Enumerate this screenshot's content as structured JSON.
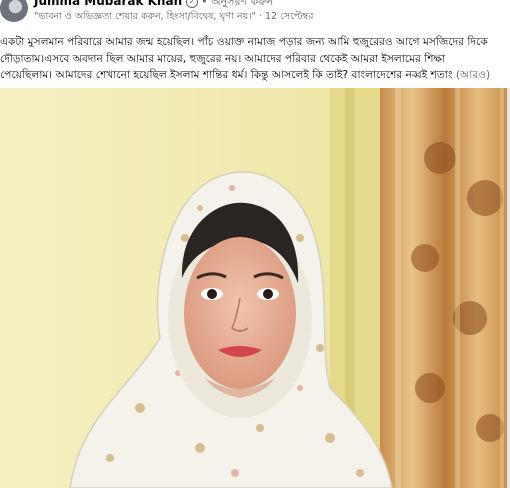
{
  "post": {
    "author": "Jumma Mubarak Khan",
    "follow_label": "• অনুসরণ করুন",
    "quote": "\"ভাবনা ও অভিজ্ঞতা শেয়ার করুন, হিংসা/বিদ্বেষ, ঘৃণা নয়।\"",
    "date": "· 12 সেপ্টেম্বর",
    "body_lines": [
      "একটা মুসলমান পরিবারে আমার জন্ম হয়েছিল। পাঁচ ওয়াক্ত নামাজ পড়ার জন্য আমি হুজুরেরও আগে মসজিদের দিকে",
      "দৌড়াতাম।এসবে অবদান ছিল আমার মায়ের, হুজুরের নয়। আমাদের পরিবার থেকেই আমরা ইসলামের শিক্ষা",
      "পেয়েছিলাম। আমাদের শেখানো হয়েছিল ইসলাম শান্তির ধর্ম। কিন্তু আসলেই কি তাই? বাংলাদেশের নব্বই শতাং"
    ],
    "see_more": "(আরও)"
  },
  "colors": {
    "wall": "#f2ecb4",
    "curtain": "#d9a866",
    "headscarf": "#f4f2ea"
  }
}
